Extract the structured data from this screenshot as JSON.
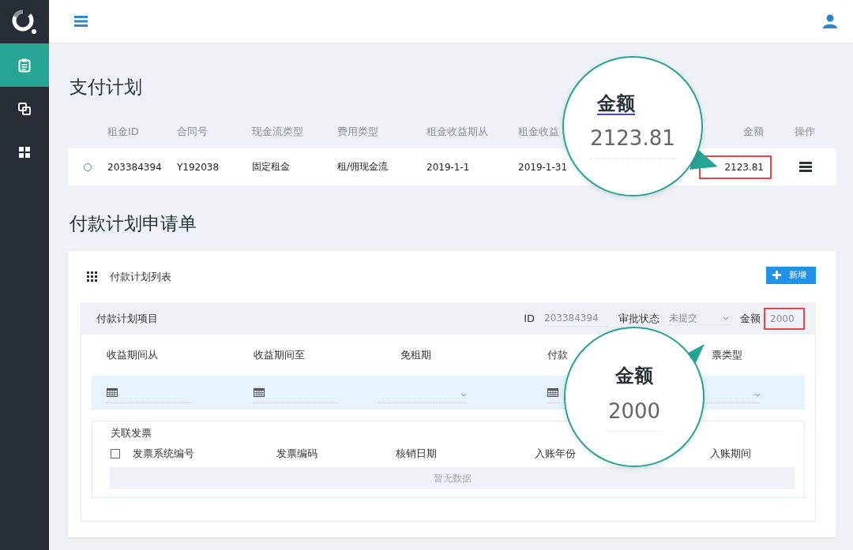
{
  "sidebar": {
    "items": [
      {
        "kind": "clipboard",
        "selected": true
      },
      {
        "kind": "copy",
        "selected": false
      },
      {
        "kind": "grid",
        "selected": false
      }
    ]
  },
  "payment_plan": {
    "title": "支付计划",
    "columns": [
      "租金ID",
      "合同号",
      "现金流类型",
      "费用类型",
      "租金收益期从",
      "租金收益",
      "金额",
      "操作"
    ],
    "rows": [
      {
        "selected": false,
        "cells": [
          "203384394",
          "Y192038",
          "固定租金",
          "租/佣现金流",
          "2019-1-1",
          "2019-1-31"
        ],
        "amount": "2123.81",
        "amount_highlighted": true
      }
    ]
  },
  "application": {
    "title": "付款计划申请单",
    "card_title": "付款计划列表",
    "add_button": "新增",
    "item_bar": {
      "title": "付款计划项目",
      "id_label": "ID",
      "id_value": "203384394",
      "status_label": "审批状态",
      "status_value": "未提交",
      "amount_label": "金额",
      "amount_value": "2000",
      "amount_highlighted": true
    },
    "fields": [
      {
        "label": "收益期间从",
        "kind": "date"
      },
      {
        "label": "收益期间至",
        "kind": "date"
      },
      {
        "label": "免租期",
        "kind": "select"
      },
      {
        "label": "付款",
        "kind": "date"
      },
      {
        "label": "票类型",
        "kind": "select"
      }
    ],
    "invoices": {
      "title": "关联发票",
      "select_all_checked": false,
      "columns": [
        "发票系统编号",
        "发票编码",
        "核销日期",
        "入账年份",
        "入账期间"
      ],
      "empty_text": "暂无数据"
    }
  },
  "callouts": [
    {
      "label": "金额",
      "value": "2123.81"
    },
    {
      "label": "金额",
      "value": "2000"
    }
  ]
}
